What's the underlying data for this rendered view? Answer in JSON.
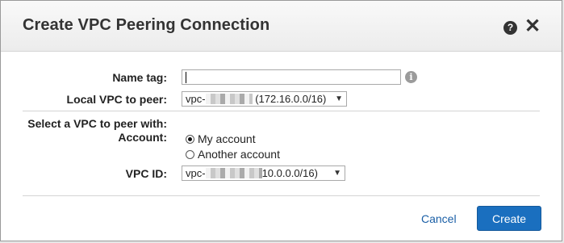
{
  "dialog": {
    "title": "Create VPC Peering Connection",
    "help_icon": "question-circle-icon",
    "close_icon": "close-x-icon"
  },
  "form": {
    "name_tag": {
      "label": "Name tag:",
      "value": "",
      "info_icon": "info-icon"
    },
    "local_vpc": {
      "label": "Local VPC to peer:",
      "prefix": "vpc-",
      "suffix": "(172.16.0.0/16)"
    },
    "peer_section": {
      "heading": "Select a VPC to peer with:",
      "account_label": "Account:",
      "options": [
        {
          "label": "My account",
          "selected": true
        },
        {
          "label": "Another account",
          "selected": false
        }
      ]
    },
    "vpc_id": {
      "label": "VPC ID:",
      "prefix": "vpc-",
      "suffix": "10.0.0.0/16)"
    }
  },
  "footer": {
    "cancel_label": "Cancel",
    "create_label": "Create"
  },
  "colors": {
    "primary_button": "#1a6fbf",
    "link": "#1a5fa6",
    "header_bg": "#efefef"
  }
}
